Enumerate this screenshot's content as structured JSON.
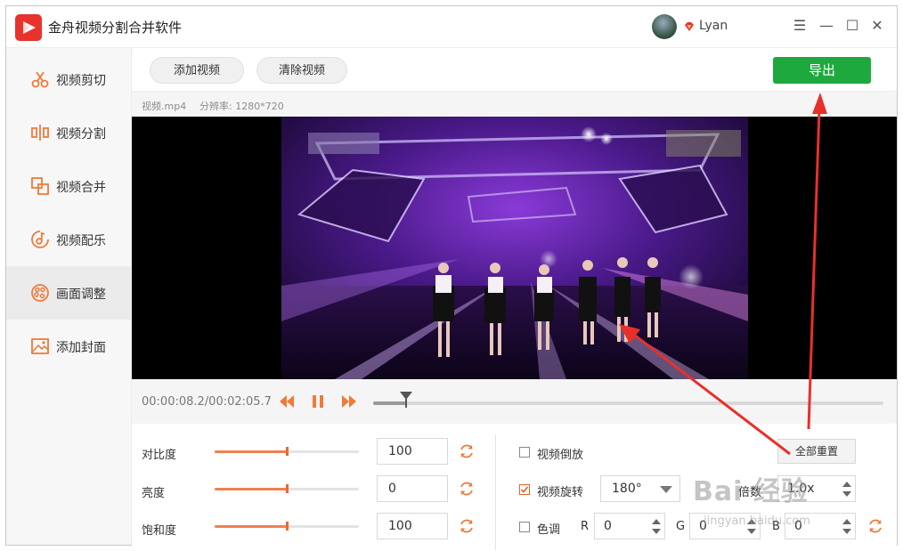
{
  "app": {
    "title": "金舟视频分割合并软件",
    "username": "Lyan"
  },
  "sidebar": {
    "items": [
      {
        "label": "视频剪切",
        "icon": "scissors-icon",
        "active": false
      },
      {
        "label": "视频分割",
        "icon": "split-icon",
        "active": false
      },
      {
        "label": "视频合并",
        "icon": "merge-icon",
        "active": false
      },
      {
        "label": "视频配乐",
        "icon": "music-icon",
        "active": false
      },
      {
        "label": "画面调整",
        "icon": "palette-icon",
        "active": true
      },
      {
        "label": "添加封面",
        "icon": "image-icon",
        "active": false
      }
    ]
  },
  "toolbar": {
    "add_label": "添加视频",
    "clear_label": "清除视频",
    "export_label": "导出"
  },
  "file": {
    "name": "视频.mp4",
    "resolution": "分辨率: 1280*720"
  },
  "timeline": {
    "time": "00:00:08.2/00:02:05.7",
    "progress": 0.064
  },
  "adjust": {
    "contrast": {
      "label": "对比度",
      "value": "100",
      "level": 0.5
    },
    "brightness": {
      "label": "亮度",
      "value": "0",
      "level": 0.5
    },
    "saturation": {
      "label": "饱和度",
      "value": "100",
      "level": 0.5
    },
    "reverse": {
      "label": "视频倒放",
      "checked": false
    },
    "reset_all": "全部重置",
    "rotate": {
      "label": "视频旋转",
      "checked": true,
      "value": "180°"
    },
    "speed": {
      "label": "倍数",
      "value": "1.0x"
    },
    "tone": {
      "label": "色调",
      "checked": false,
      "r_label": "R",
      "r": "0",
      "g_label": "G",
      "g": "0",
      "b_label": "B",
      "b": "0"
    }
  },
  "watermark": {
    "brand": "Bai 经验",
    "url": "jingyan.baidu.com"
  },
  "colors": {
    "accent": "#e8622c",
    "export": "#1ea93e",
    "arrow": "#e8302a"
  }
}
